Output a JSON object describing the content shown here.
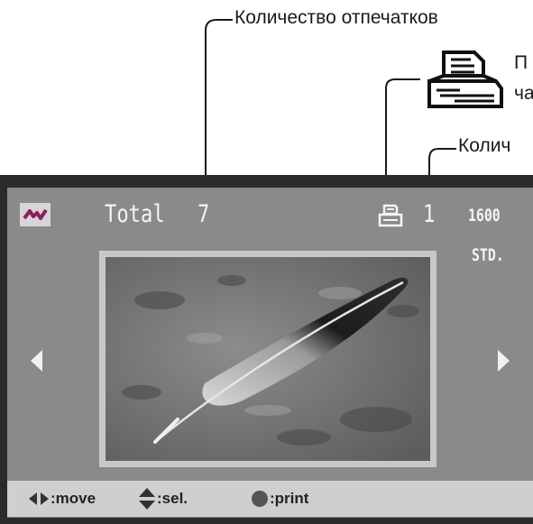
{
  "callouts": {
    "total_prints": "Количество отпечатков",
    "print_mark_line1": "П",
    "print_mark_line2": "ча",
    "copies": "Колич"
  },
  "lcd": {
    "total_label": "Total",
    "total_count": "7",
    "print_count": "1",
    "iso": "1600",
    "quality": "STD."
  },
  "footer": {
    "move_label": ":move",
    "select_label": ":sel.",
    "print_label": ":print"
  },
  "colors": {
    "lcd_background": "#8a8a8a",
    "footer_background": "#cfcfcf",
    "mode_icon_accent": "#8a1f5c"
  },
  "icons": {
    "mode": "playback-mode-icon",
    "print_order": "printer-icon",
    "callout_print": "dpof-print-icon"
  }
}
